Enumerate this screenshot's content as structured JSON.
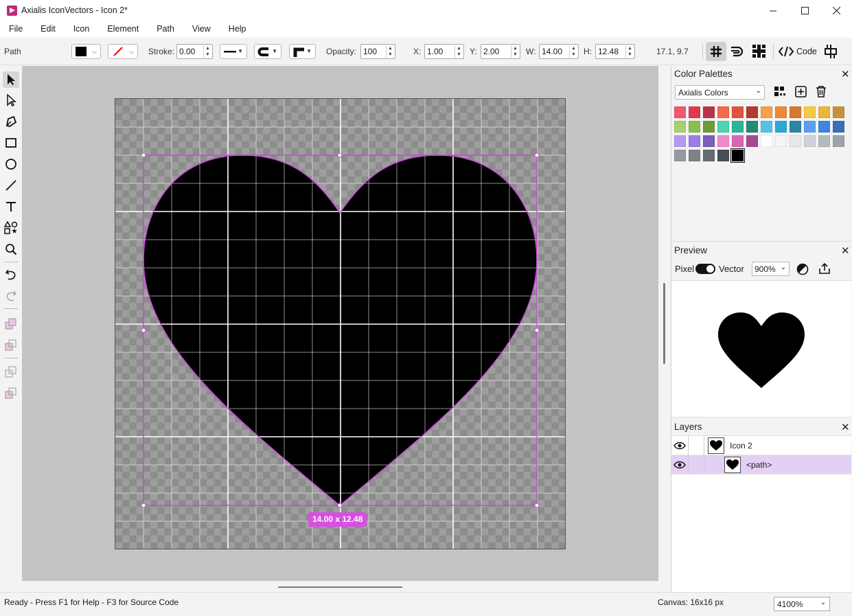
{
  "window": {
    "title": "Axialis IconVectors - Icon 2*",
    "app_icon": "axialis-logo-icon",
    "controls": [
      "minimize-icon",
      "maximize-icon",
      "close-icon"
    ]
  },
  "menu": [
    "File",
    "Edit",
    "Icon",
    "Element",
    "Path",
    "View",
    "Help"
  ],
  "toolbar": {
    "element_type": "Path",
    "fill_color": "#000000",
    "stroke_color": "#ff0000",
    "stroke_label": "Stroke:",
    "stroke_value": "0.00",
    "opacity_label": "Opacity:",
    "opacity_value": "100",
    "x_label": "X:",
    "x_value": "1.00",
    "y_label": "Y:",
    "y_value": "2.00",
    "w_label": "W:",
    "w_value": "14.00",
    "h_label": "H:",
    "h_value": "12.48",
    "coords": "17.1, 9.7",
    "code_label": "Code",
    "icons": [
      "grid-icon",
      "snap-icon",
      "pixel-align-icon",
      "code-icon",
      "center-icon"
    ]
  },
  "tools": [
    "select-arrow-icon",
    "direct-select-icon",
    "pen-icon",
    "rectangle-icon",
    "ellipse-icon",
    "line-icon",
    "text-icon",
    "shapes-icon",
    "zoom-icon",
    "undo-icon",
    "redo-icon",
    "combine-icon",
    "subtract-icon",
    "intersect-icon",
    "exclude-icon"
  ],
  "canvas": {
    "selection_size": "14.00 x 12.48",
    "selection_color": "#c847d8",
    "shape_fill": "#000000"
  },
  "color_palettes": {
    "title": "Color Palettes",
    "selected_palette": "Axialis Colors",
    "icons": [
      "palette-grid-icon",
      "add-icon",
      "trash-icon"
    ],
    "swatches": [
      "#ef5a6f",
      "#dd3b4d",
      "#b8334a",
      "#f36a4a",
      "#e0533c",
      "#b33a2e",
      "#f4a14a",
      "#ee8a35",
      "#d9782f",
      "#f6c845",
      "#eab63b",
      "#c99238",
      "#a8d06a",
      "#8cbd4e",
      "#6e9a3d",
      "#4fd3b0",
      "#2db39a",
      "#238a73",
      "#56c2e6",
      "#2ea7d8",
      "#2d86a6",
      "#5c9ef0",
      "#3f86e0",
      "#3a6fb8",
      "#b59bf0",
      "#9b7de6",
      "#7b5fb8",
      "#f08ac8",
      "#d966b5",
      "#a54a8f",
      "#ffffff",
      "#f4f4f6",
      "#e6e8ec",
      "#cdd1d8",
      "#b5bac2",
      "#9da3ab",
      "#959aa1",
      "#7d828a",
      "#656a73",
      "#474c56",
      "#000000"
    ]
  },
  "preview": {
    "title": "Preview",
    "pixel_label": "Pixel",
    "vector_label": "Vector",
    "zoom": "900%",
    "icons": [
      "contrast-icon",
      "export-icon"
    ]
  },
  "layers": {
    "title": "Layers",
    "items": [
      {
        "label": "Icon 2"
      },
      {
        "label": "<path>"
      }
    ]
  },
  "status": {
    "text": "Ready - Press F1 for Help - F3 for Source Code",
    "canvas_size": "Canvas: 16x16 px",
    "zoom": "4100%"
  }
}
